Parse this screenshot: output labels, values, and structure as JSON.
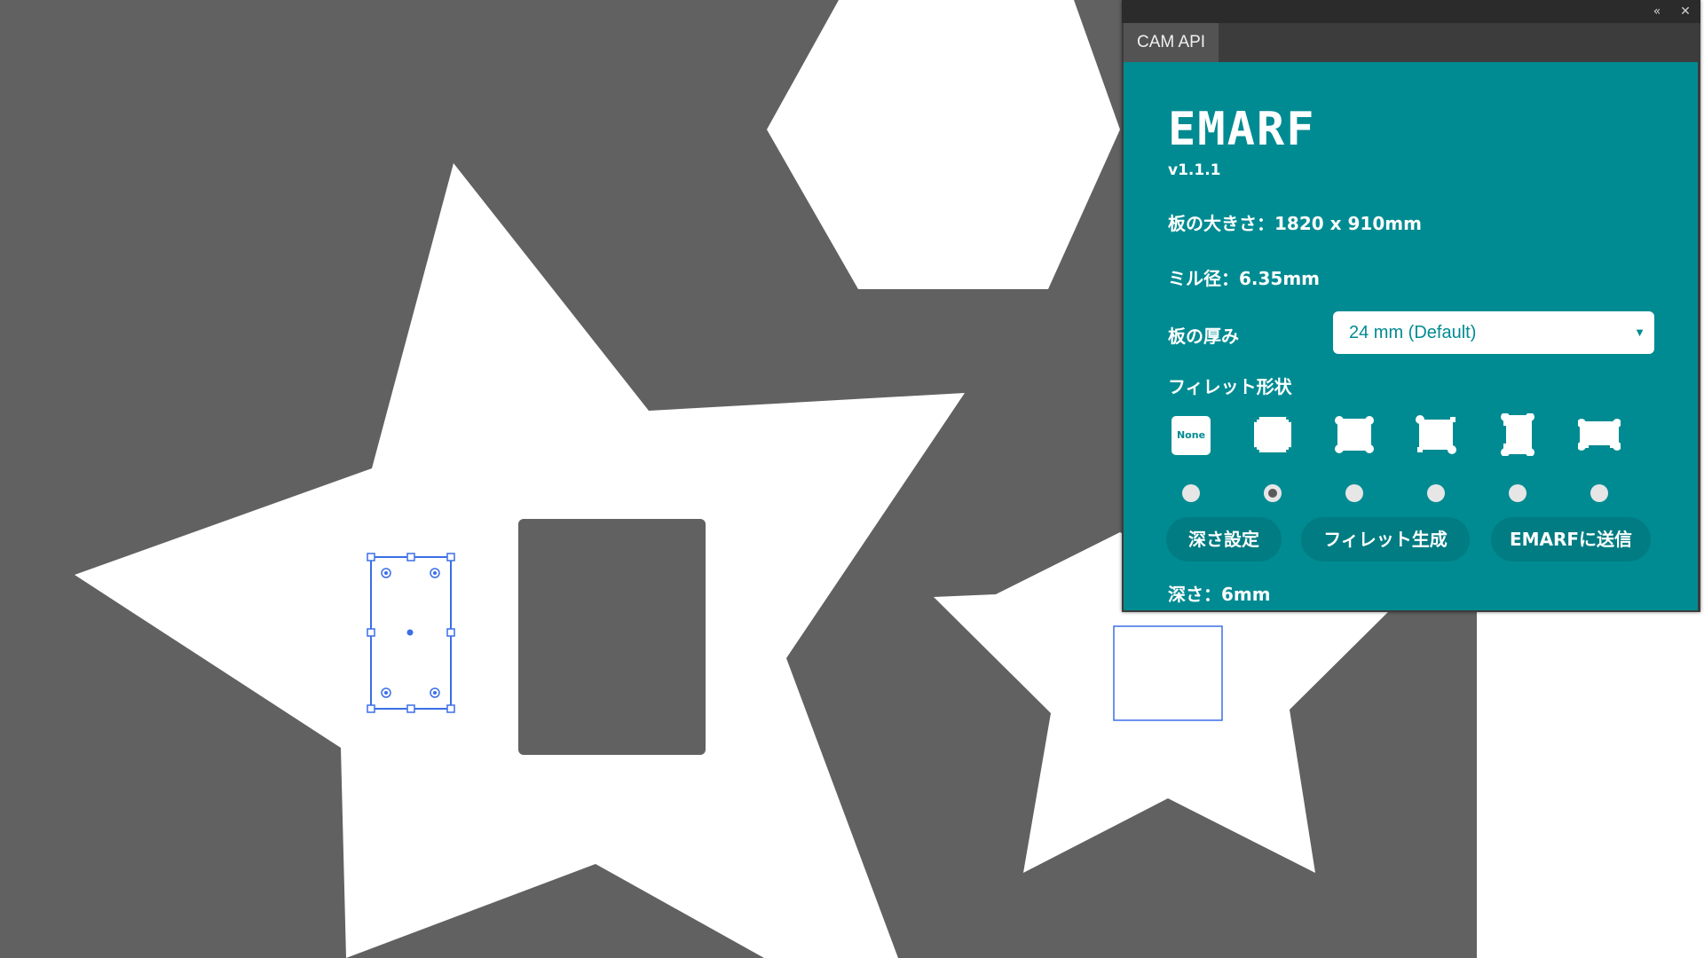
{
  "panel": {
    "tab_label": "CAM API",
    "collapse_icon": "double-chevron-left-icon",
    "close_icon": "close-icon",
    "logo_text": "EMARF",
    "version": "v1.1.1",
    "board_size": "板の大きさ：1820 x 910mm",
    "mill_diameter": "ミル径：6.35mm",
    "thickness_label": "板の厚み",
    "thickness_value": "24 mm (Default)",
    "fillet_label": "フィレット形状",
    "fillet_options": [
      {
        "label": "None",
        "icon": "fillet-none-icon",
        "selected": false
      },
      {
        "label": "",
        "icon": "fillet-rounded-square-icon",
        "selected": true
      },
      {
        "label": "",
        "icon": "fillet-dogbone-corners-icon",
        "selected": false
      },
      {
        "label": "",
        "icon": "fillet-dogbone-diagonal-icon",
        "selected": false
      },
      {
        "label": "",
        "icon": "fillet-tbone-vertical-icon",
        "selected": false
      },
      {
        "label": "",
        "icon": "fillet-tbone-horizontal-icon",
        "selected": false
      }
    ],
    "buttons": {
      "depth": "深さ設定",
      "fillet": "フィレット生成",
      "send": "EMARFに送信"
    },
    "depth_status": "深さ：6mm",
    "colors": {
      "accent": "#008b92",
      "button": "#007c82",
      "canvas": "#616161",
      "selection": "#3b6ee8"
    }
  }
}
